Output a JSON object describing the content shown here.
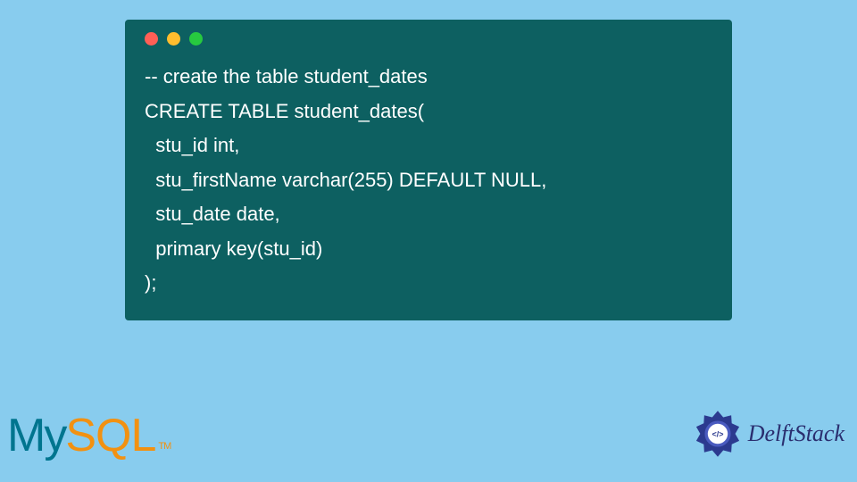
{
  "code": {
    "line1": "-- create the table student_dates",
    "line2": "CREATE TABLE student_dates(",
    "line3": "  stu_id int,",
    "line4": "  stu_firstName varchar(255) DEFAULT NULL,",
    "line5": "  stu_date date,",
    "line6": "  primary key(stu_id)",
    "line7": ");"
  },
  "logos": {
    "mysql_my": "My",
    "mysql_sql": "SQL",
    "mysql_tm": "TM",
    "delftstack": "DelftStack"
  },
  "colors": {
    "background": "#88ccee",
    "window": "#0d6061"
  }
}
